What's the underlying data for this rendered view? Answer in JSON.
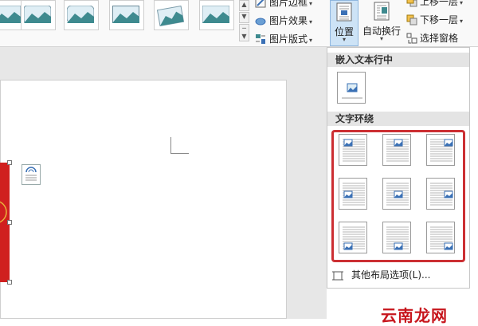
{
  "ribbon": {
    "picture_styles": [
      "style-1",
      "style-2",
      "style-3",
      "style-4",
      "style-5",
      "style-6"
    ],
    "commands": {
      "picture_border": "图片边框",
      "picture_effects": "图片效果",
      "picture_layout": "图片版式"
    },
    "arrange": {
      "position": "位置",
      "wrap_text": "自动换行",
      "bring_forward": "上移一层",
      "send_backward": "下移一层",
      "selection_pane": "选择窗格"
    },
    "dropdown_arrow": "▾"
  },
  "panel": {
    "inline_header": "嵌入文本行中",
    "wrap_header": "文字环绕",
    "wrap_options": [
      {
        "name": "top-left"
      },
      {
        "name": "top-center"
      },
      {
        "name": "top-right"
      },
      {
        "name": "middle-left"
      },
      {
        "name": "middle-center"
      },
      {
        "name": "middle-right"
      },
      {
        "name": "bottom-left"
      },
      {
        "name": "bottom-center"
      },
      {
        "name": "bottom-right"
      }
    ],
    "more_options": "其他布局选项(L)..."
  },
  "watermark": "云南龙网",
  "colors": {
    "highlight_border": "#cc2f33",
    "selected_button": "#cde3f6",
    "image_red": "#d0201f"
  }
}
